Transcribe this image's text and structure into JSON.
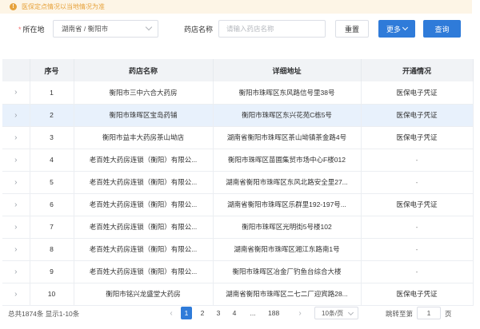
{
  "notice": {
    "text": "医保定点情况以当地情况为准"
  },
  "filters": {
    "location_label": "所在地",
    "location_value": "湖南省 / 衡阳市",
    "pharmacy_label": "药店名称",
    "pharmacy_placeholder": "请输入药店名称",
    "reset_label": "重置",
    "more_label": "更多",
    "search_label": "查询"
  },
  "table": {
    "columns": [
      "序号",
      "药店名称",
      "详细地址",
      "开通情况"
    ],
    "rows": [
      {
        "no": "1",
        "name": "衡阳市三中六合大药房",
        "address": "衡阳市珠晖区东风路信号里38号",
        "status": "医保电子凭证"
      },
      {
        "no": "2",
        "name": "衡阳市珠晖区宝岛药铺",
        "address": "衡阳市珠晖区东兴花苑C栋5号",
        "status": "医保电子凭证"
      },
      {
        "no": "3",
        "name": "衡阳市益丰大药房茶山坳店",
        "address": "湖南省衡阳市珠晖区茶山坳镇茶金路4号",
        "status": "医保电子凭证"
      },
      {
        "no": "4",
        "name": "老百姓大药房连锁（衡阳）有限公...",
        "address": "衡阳市珠晖区苗圃集贸市场中心F楼012",
        "status": "-"
      },
      {
        "no": "5",
        "name": "老百姓大药房连锁（衡阳）有限公...",
        "address": "湖南省衡阳市珠晖区东风北路安全里27...",
        "status": "-"
      },
      {
        "no": "6",
        "name": "老百姓大药房连锁（衡阳）有限公...",
        "address": "湖南省衡阳市珠晖区乐群里192-197号...",
        "status": "医保电子凭证"
      },
      {
        "no": "7",
        "name": "老百姓大药房连锁（衡阳）有限公...",
        "address": "衡阳市珠晖区光明街5号楼102",
        "status": "-"
      },
      {
        "no": "8",
        "name": "老百姓大药房连锁（衡阳）有限公...",
        "address": "湖南省衡阳市珠晖区湘江东路南1号",
        "status": "-"
      },
      {
        "no": "9",
        "name": "老百姓大药房连锁（衡阳）有限公...",
        "address": "衡阳市珠晖区冶金厂钓鱼台综合大楼",
        "status": "-"
      },
      {
        "no": "10",
        "name": "衡阳市铭兴龙盛堂大药房",
        "address": "湖南省衡阳市珠晖区二七二厂迎宾路28...",
        "status": "医保电子凭证"
      }
    ]
  },
  "pager": {
    "total_text": "总共1874条  显示1-10条",
    "prev": "‹",
    "pages": [
      "1",
      "2",
      "3",
      "4"
    ],
    "ellipsis": "...",
    "last_page": "188",
    "next": "›",
    "page_size": "10条/页",
    "jump_label": "跳转至第",
    "jump_value": "1",
    "jump_suffix": "页"
  }
}
